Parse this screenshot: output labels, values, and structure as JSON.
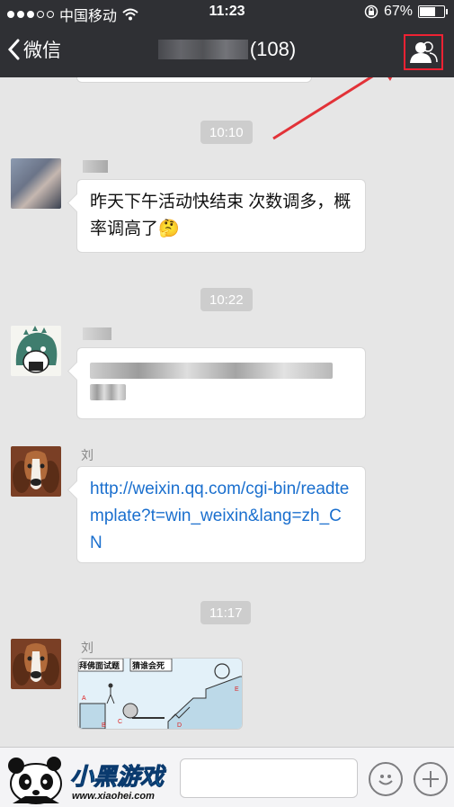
{
  "status": {
    "carrier": "中国移动",
    "time": "11:23",
    "battery_text": "67%",
    "battery_level": 0.67
  },
  "nav": {
    "back_label": "微信",
    "member_count": "(108)"
  },
  "chat": {
    "prev_partial": "",
    "t1": "10:10",
    "msg1": {
      "sender": "",
      "text": "昨天下午活动快结束 次数调多，概率调高了🤔"
    },
    "t2": "10:22",
    "msg2": {
      "sender": ""
    },
    "msg3": {
      "sender": "刘",
      "text": "http://weixin.qq.com/cgi-bin/readtemplate?t=win_weixin&lang=zh_CN"
    },
    "t3": "11:17",
    "msg4": {
      "sender": "刘",
      "img_label_1": "拜佛面试题",
      "img_label_2": "猜谁会死"
    }
  },
  "watermark": {
    "brand": "小黑游戏",
    "url": "www.xiaohei.com"
  },
  "colors": {
    "accent_red": "#e23238",
    "link_blue": "#1a6fce",
    "nav_bg": "#2f3034"
  }
}
